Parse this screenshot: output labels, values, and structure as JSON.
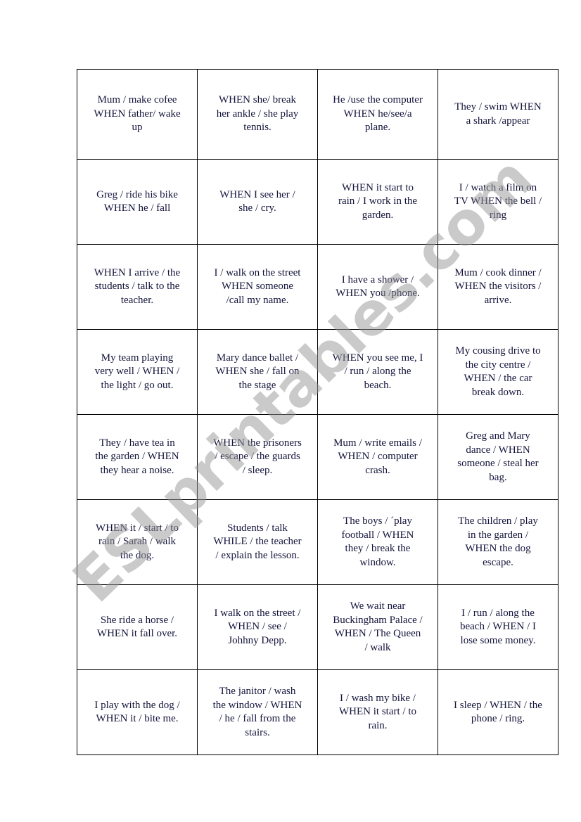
{
  "watermark": "ESLprintables.com",
  "colors": {
    "text": "#14143c",
    "border": "#000000",
    "watermark": "#969696"
  },
  "cards": [
    [
      "Mum / make cofee\nWHEN father/ wake\nup",
      "WHEN she/ break\nher ankle / she play\ntennis.",
      "He /use the computer\nWHEN he/see/a\nplane.",
      "They / swim  WHEN\na shark /appear"
    ],
    [
      "Greg / ride his bike\nWHEN he / fall",
      "WHEN I see her /\nshe / cry.",
      "WHEN it start to\nrain / I work in the\ngarden.",
      "I / watch a film on\nTV WHEN the bell /\nring"
    ],
    [
      "WHEN I arrive / the\nstudents / talk to the\nteacher.",
      "I / walk on the street\nWHEN someone\n/call my name.",
      "I have a shower /\nWHEN you /phone.",
      "Mum / cook dinner /\nWHEN the visitors /\narrive."
    ],
    [
      "My team playing\nvery well / WHEN /\nthe light / go out.",
      "Mary dance ballet /\nWHEN she / fall on\nthe stage",
      "WHEN you see me, I\n/ run / along the\nbeach.",
      "My cousing drive to\nthe city centre /\nWHEN / the car\nbreak down."
    ],
    [
      "They / have tea in\nthe garden / WHEN\nthey hear a noise.",
      "WHEN the prisoners\n/ escape / the guards\n/ sleep.",
      "Mum / write emails /\nWHEN / computer\ncrash.",
      "Greg and Mary\ndance / WHEN\nsomeone / steal her\nbag."
    ],
    [
      "WHEN it / start / to\nrain / Sarah / walk\nthe dog.",
      "Students / talk\nWHILE / the teacher\n/ explain the lesson.",
      "The boys / ´play\nfootball / WHEN\nthey / break the\nwindow.",
      "The children / play\nin the garden /\nWHEN the dog\nescape."
    ],
    [
      "She ride a horse /\nWHEN it fall over.",
      "I walk on the street /\nWHEN / see  /\nJohhny Depp.",
      "We wait near\nBuckingham Palace /\nWHEN / The Queen\n/ walk",
      "I / run / along the\nbeach / WHEN / I\nlose some money."
    ],
    [
      "I play with the dog /\nWHEN it / bite me.",
      "The janitor / wash\nthe window / WHEN\n/ he / fall from the\nstairs.",
      "I / wash my bike /\nWHEN it start / to\nrain.",
      "I sleep / WHEN / the\nphone / ring."
    ]
  ]
}
